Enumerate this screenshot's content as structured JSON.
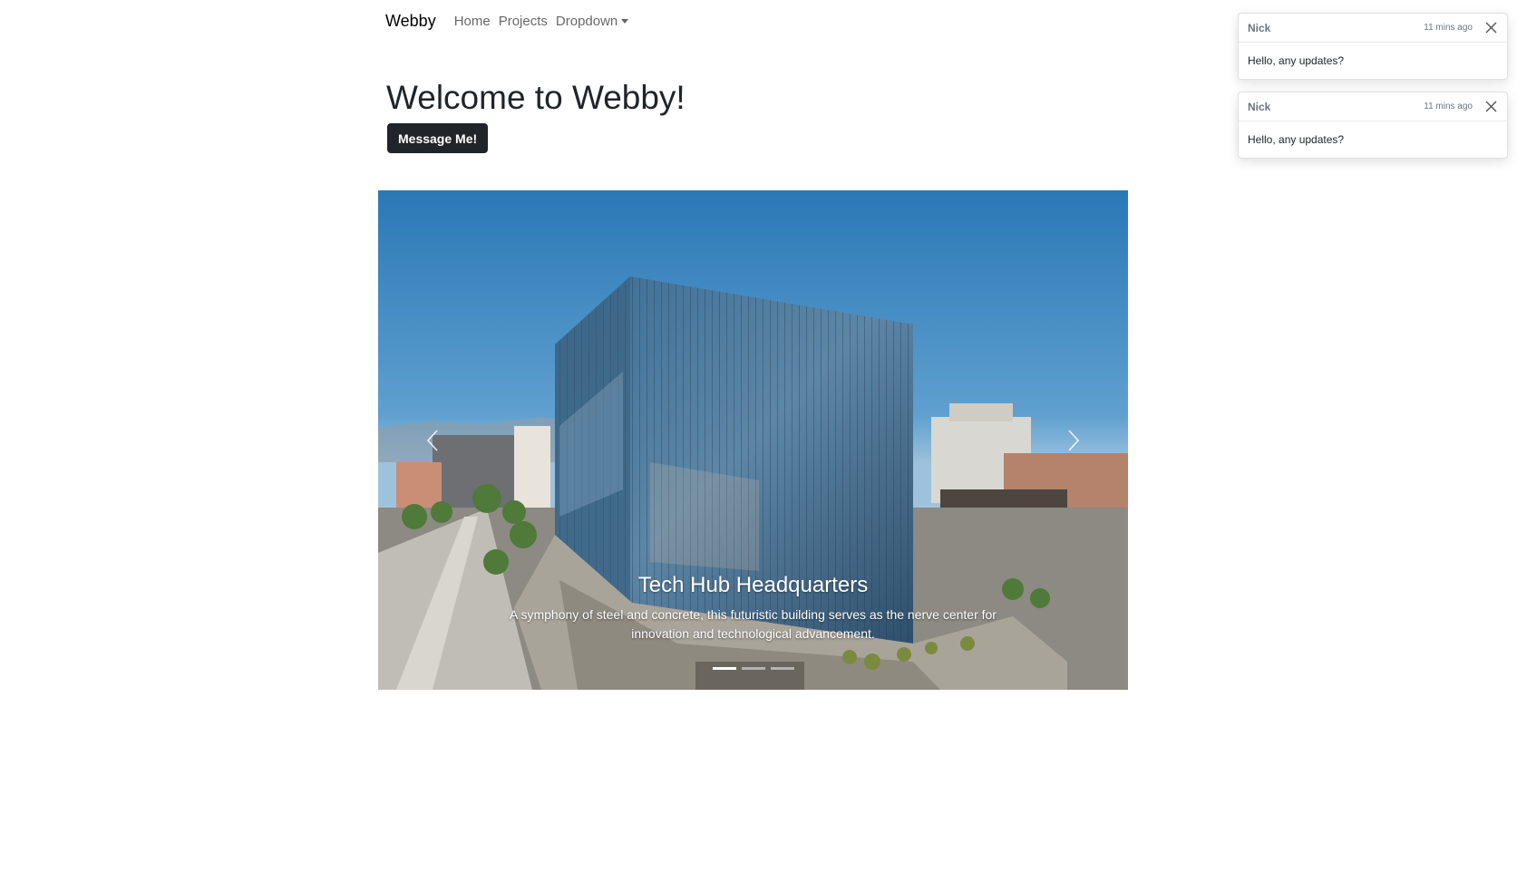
{
  "navbar": {
    "brand": "Webby",
    "links": [
      "Home",
      "Projects"
    ],
    "dropdown_label": "Dropdown"
  },
  "hero": {
    "title": "Welcome to Webby!",
    "button_label": "Message Me!"
  },
  "carousel": {
    "slide_title": "Tech Hub Headquarters",
    "slide_text": "A symphony of steel and concrete, this futuristic building serves as the nerve center for innovation and technological advancement.",
    "indicator_count": 3,
    "active_index": 0
  },
  "toasts": [
    {
      "sender": "Nick",
      "time": "11 mins ago",
      "message": "Hello, any updates?"
    },
    {
      "sender": "Nick",
      "time": "11 mins ago",
      "message": "Hello, any updates?"
    }
  ],
  "icons": {
    "prev": "chevron-left-icon",
    "next": "chevron-right-icon",
    "close": "close-icon",
    "caret": "caret-down-icon"
  }
}
